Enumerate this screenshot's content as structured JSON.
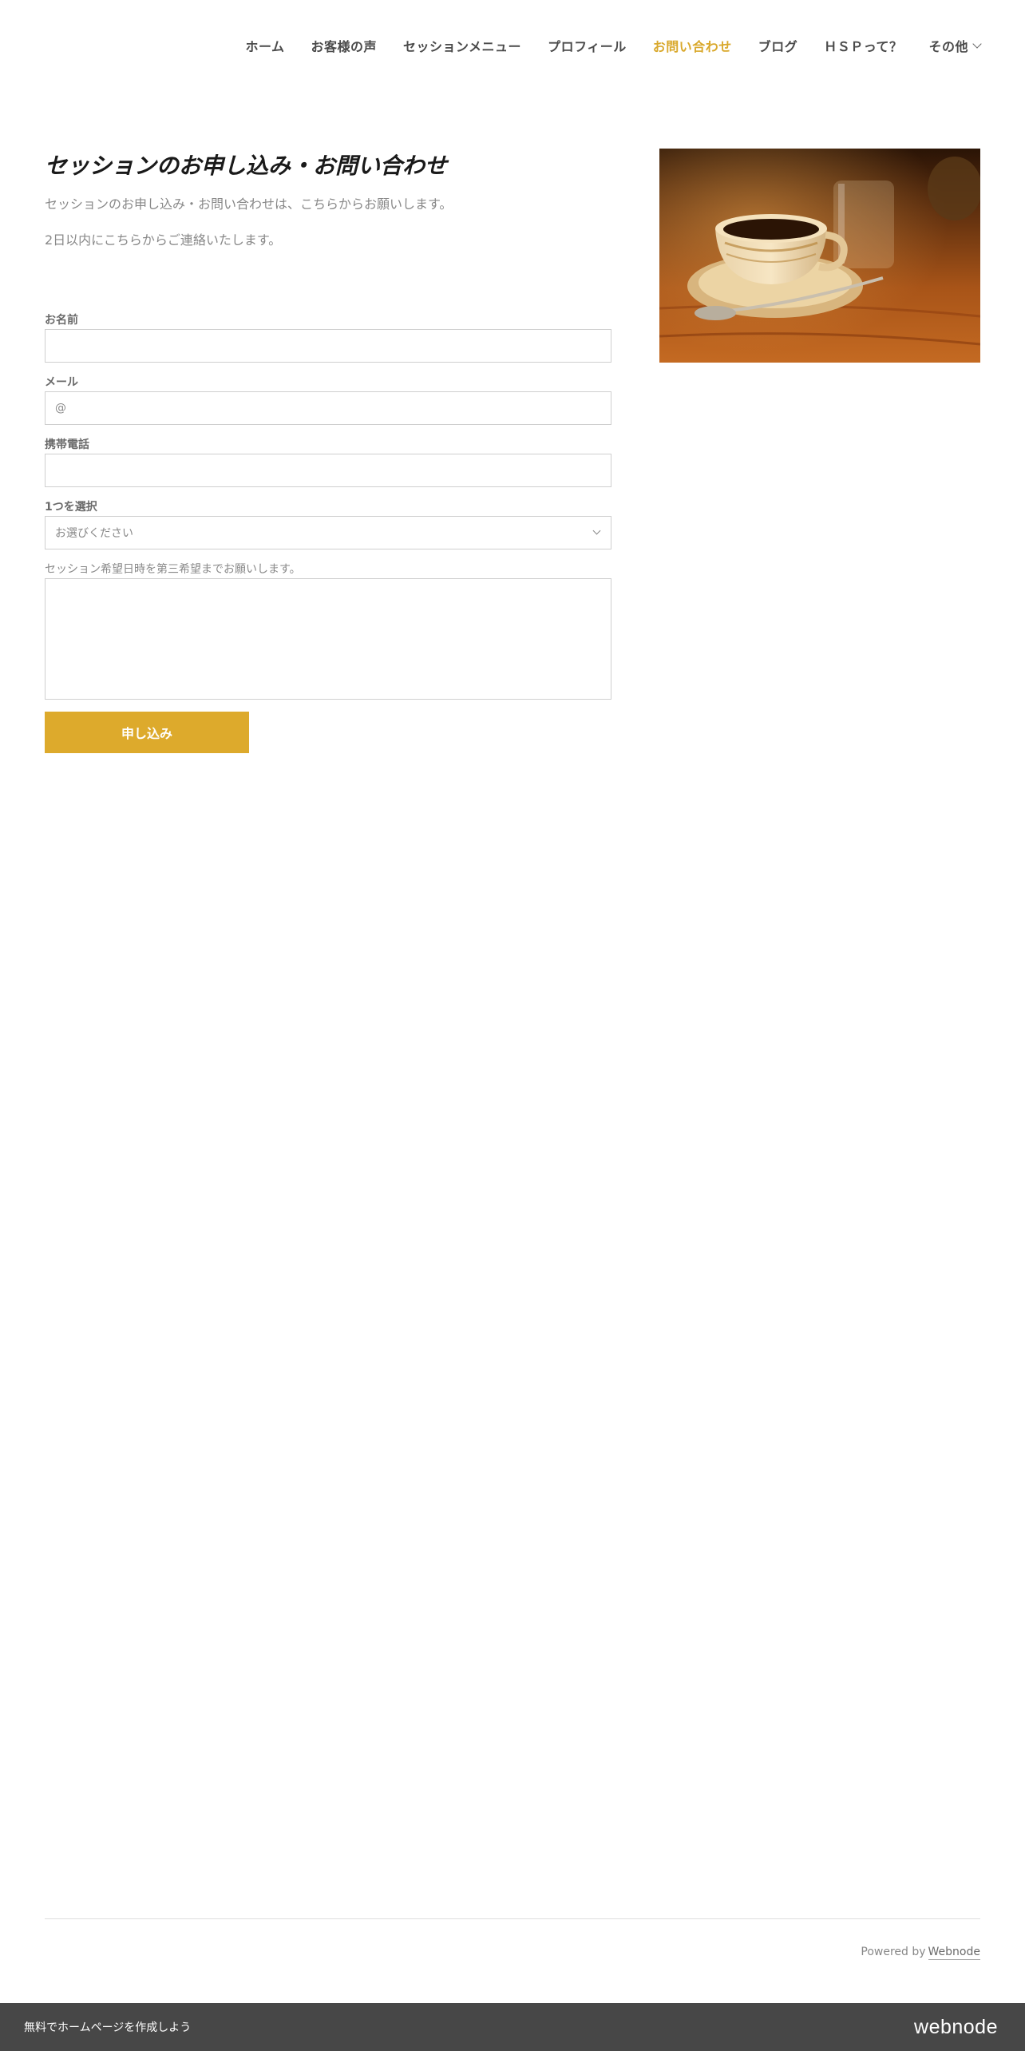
{
  "nav": {
    "items": [
      {
        "label": "ホーム"
      },
      {
        "label": "お客様の声"
      },
      {
        "label": "セッションメニュー"
      },
      {
        "label": "プロフィール"
      },
      {
        "label": "お問い合わせ",
        "active": true
      },
      {
        "label": "ブログ"
      },
      {
        "label": "ＨＳＰって？"
      },
      {
        "label": "その他"
      }
    ]
  },
  "page": {
    "title": "セッションのお申し込み・お問い合わせ",
    "intro_1": "セッションのお申し込み・お問い合わせは、こちらからお願いします。",
    "intro_2": "2日以内にこちらからご連絡いたします。"
  },
  "form": {
    "name_label": "お名前",
    "email_label": "メール",
    "email_placeholder": "@",
    "phone_label": "携帯電話",
    "select_label": "1つを選択",
    "select_value": "お選びください",
    "message_label": "セッション希望日時を第三希望までお願いします。",
    "submit_label": "申し込み"
  },
  "footer": {
    "powered_prefix": "Powered by",
    "powered_link": "Webnode"
  },
  "bottom_bar": {
    "cta": "無料でホームページを作成しよう",
    "logo": "webnode"
  },
  "colors": {
    "accent": "#ddaa2c",
    "nav_active": "#d9a82b",
    "bottom_bar": "#474747"
  }
}
